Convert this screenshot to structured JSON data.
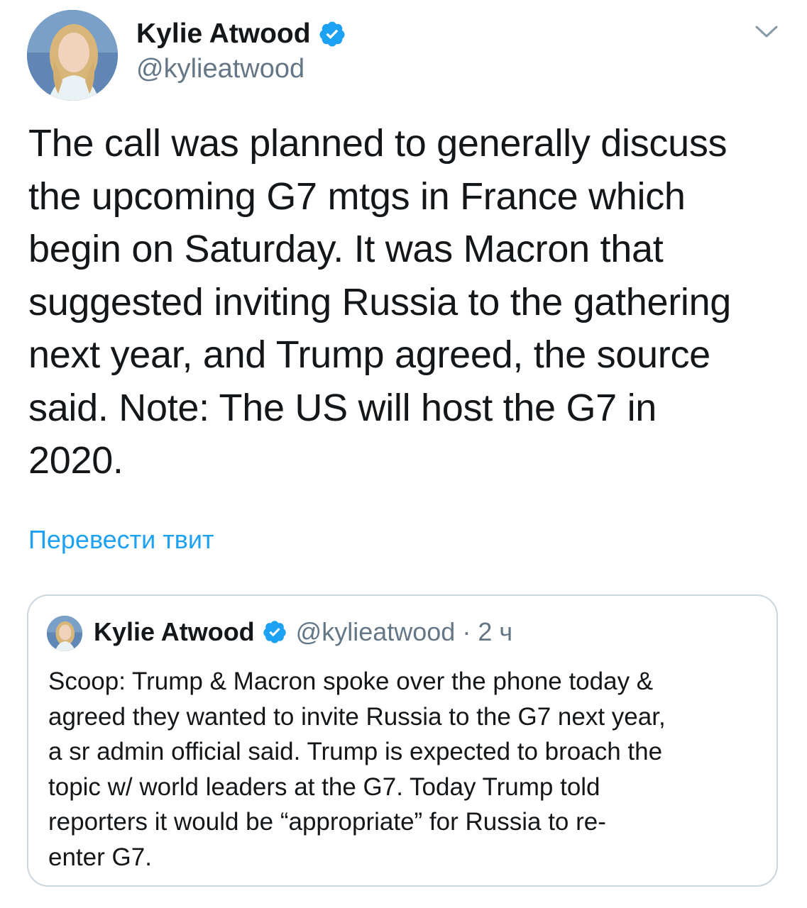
{
  "tweet": {
    "author_name": "Kylie Atwood",
    "author_handle": "@kylieatwood",
    "verified_icon": "verified-badge-icon",
    "menu_icon": "chevron-down-icon",
    "text": "The call was planned to generally discuss\nthe upcoming G7 mtgs in France which\nbegin on Saturday. It was Macron that\nsuggested inviting Russia to the gathering\nnext year, and Trump agreed, the source\nsaid. Note: The US will host the G7 in\n2020.",
    "translate_label": "Перевести твит"
  },
  "quoted_tweet": {
    "author_name": "Kylie Atwood",
    "author_handle": "@kylieatwood",
    "separator": "·",
    "time": "2 ч",
    "text": "Scoop: Trump & Macron spoke over the phone today &\nagreed they wanted to invite Russia to the G7 next year,\na sr admin official said. Trump is expected to broach the\ntopic w/ world leaders at the G7. Today Trump told\nreporters it would be “appropriate” for Russia to re-\nenter G7."
  },
  "colors": {
    "text_primary": "#14171a",
    "text_secondary": "#657786",
    "link_blue": "#1da1f2",
    "border": "#ccd6dd"
  }
}
